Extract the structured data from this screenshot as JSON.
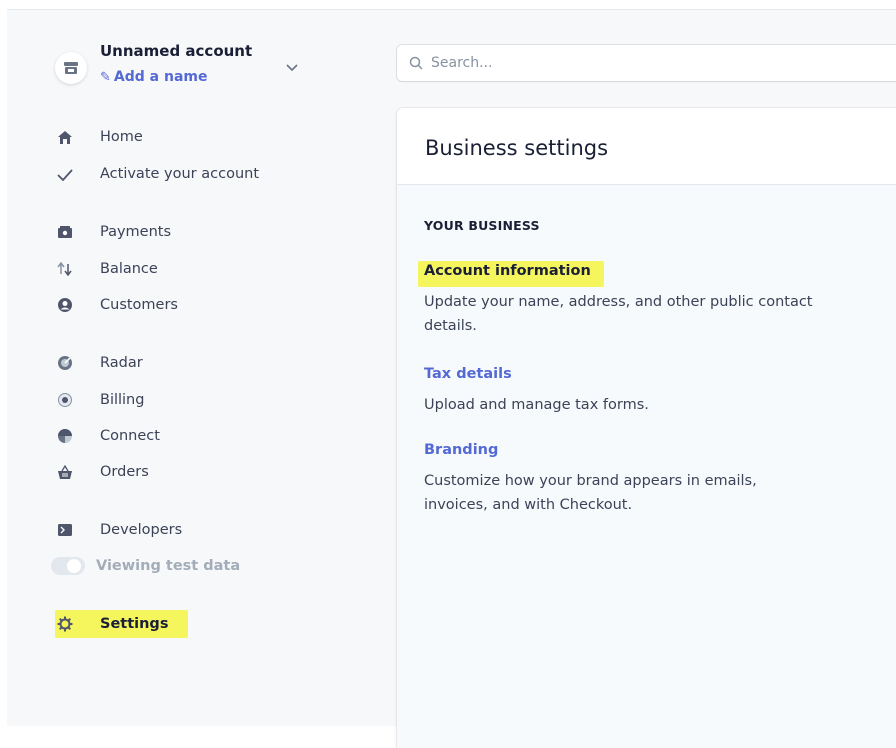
{
  "account": {
    "name": "Unnamed account",
    "add_name": "Add a name"
  },
  "search": {
    "placeholder": "Search..."
  },
  "sidebar": {
    "items": [
      {
        "label": "Home",
        "icon": "home-icon"
      },
      {
        "label": "Activate your account",
        "icon": "check-icon"
      },
      {
        "label": "Payments",
        "icon": "payments-icon"
      },
      {
        "label": "Balance",
        "icon": "balance-arrows-icon"
      },
      {
        "label": "Customers",
        "icon": "customer-icon"
      },
      {
        "label": "Radar",
        "icon": "radar-icon"
      },
      {
        "label": "Billing",
        "icon": "billing-icon"
      },
      {
        "label": "Connect",
        "icon": "connect-icon"
      },
      {
        "label": "Orders",
        "icon": "orders-basket-icon"
      },
      {
        "label": "Developers",
        "icon": "terminal-icon"
      },
      {
        "label": "Viewing test data",
        "icon": "toggle-switch"
      },
      {
        "label": "Settings",
        "icon": "gear-icon"
      }
    ]
  },
  "main": {
    "title": "Business settings",
    "section_label": "YOUR BUSINESS",
    "links": [
      {
        "title": "Account information",
        "description": "Update your name, address, and other public contact details."
      },
      {
        "title": "Tax details",
        "description": "Upload and manage tax forms."
      },
      {
        "title": "Branding",
        "description": "Customize how your brand appears in emails, invoices, and with Checkout."
      }
    ]
  },
  "colors": {
    "accent": "#5469d4",
    "highlight": "#f5f542",
    "sidebar_bg": "#f7f8fa"
  }
}
